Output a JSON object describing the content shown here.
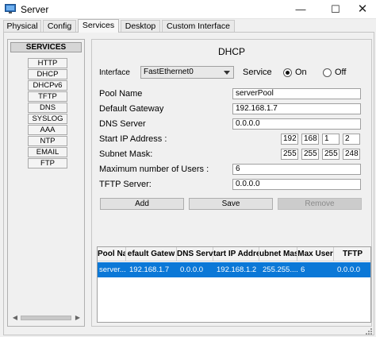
{
  "window": {
    "title": "Server",
    "min_glyph": "—",
    "max_glyph": "☐",
    "close_glyph": "✕"
  },
  "tabs": [
    {
      "label": "Physical"
    },
    {
      "label": "Config"
    },
    {
      "label": "Services",
      "active": true
    },
    {
      "label": "Desktop"
    },
    {
      "label": "Custom Interface"
    }
  ],
  "services": {
    "header": "SERVICES",
    "items": [
      "HTTP",
      "DHCP",
      "DHCPv6",
      "TFTP",
      "DNS",
      "SYSLOG",
      "AAA",
      "NTP",
      "EMAIL",
      "FTP"
    ],
    "scroll_left": "◀",
    "scroll_right": "▶"
  },
  "dhcp": {
    "title": "DHCP",
    "interface_label": "Interface",
    "interface_value": "FastEthernet0",
    "service_label": "Service",
    "on_label": "On",
    "off_label": "Off",
    "service_state": "On",
    "pool_name_label": "Pool Name",
    "pool_name_value": "serverPool",
    "default_gateway_label": "Default Gateway",
    "default_gateway_value": "192.168.1.7",
    "dns_server_label": "DNS Server",
    "dns_server_value": "0.0.0.0",
    "start_ip_label": "Start IP Address :",
    "start_ip": [
      "192",
      "168",
      "1",
      "2"
    ],
    "subnet_mask_label": "Subnet Mask:",
    "subnet_mask": [
      "255",
      "255",
      "255",
      "248"
    ],
    "max_users_label": "Maximum number of Users :",
    "max_users_value": "6",
    "tftp_label": "TFTP Server:",
    "tftp_value": "0.0.0.0",
    "add_label": "Add",
    "save_label": "Save",
    "remove_label": "Remove"
  },
  "pool_table": {
    "columns": [
      "Pool Nam",
      "efault Gatew",
      "DNS Serve",
      "tart IP Addre",
      "ubnet Mas",
      "Max User",
      "TFTP"
    ],
    "rows": [
      [
        "server...",
        "192.168.1.7",
        "0.0.0.0",
        "192.168.1.2",
        "255.255....",
        "6",
        "0.0.0.0"
      ]
    ]
  },
  "colors": {
    "selection": "#0b78d7",
    "accent_tab": "#f7f7f7"
  }
}
